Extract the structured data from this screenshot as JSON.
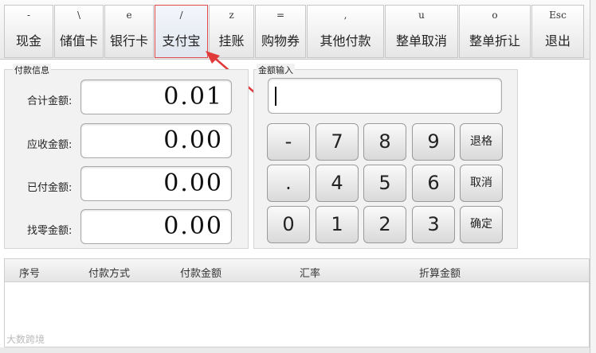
{
  "toolbar": {
    "buttons": [
      {
        "key": "-",
        "label": "现金"
      },
      {
        "key": "\\",
        "label": "储值卡"
      },
      {
        "key": "e",
        "label": "银行卡"
      },
      {
        "key": "/",
        "label": "支付宝"
      },
      {
        "key": "z",
        "label": "挂账"
      },
      {
        "key": "=",
        "label": "购物券"
      },
      {
        "key": ",",
        "label": "其他付款"
      },
      {
        "key": "u",
        "label": "整单取消"
      },
      {
        "key": "o",
        "label": "整单折让"
      },
      {
        "key": "Esc",
        "label": "退出"
      }
    ],
    "active_index": 3
  },
  "payment_info": {
    "title": "付款信息",
    "fields": [
      {
        "label": "合计金额:",
        "value": "0.01"
      },
      {
        "label": "应收金额:",
        "value": "0.00"
      },
      {
        "label": "已付金额:",
        "value": "0.00"
      },
      {
        "label": "找零金额:",
        "value": "0.00"
      }
    ]
  },
  "amount_input": {
    "title": "金额输入",
    "value": ""
  },
  "keypad": {
    "keys": [
      "-",
      "7",
      "8",
      "9",
      "退格",
      ".",
      "4",
      "5",
      "6",
      "取消",
      "0",
      "1",
      "2",
      "3",
      "确定"
    ]
  },
  "table": {
    "columns": [
      "序号",
      "付款方式",
      "付款金额",
      "汇率",
      "折算金额"
    ],
    "rows": []
  },
  "watermark": "大数跨境",
  "colors": {
    "highlight_border": "#e04a4a",
    "arrow": "#e03a3a"
  }
}
